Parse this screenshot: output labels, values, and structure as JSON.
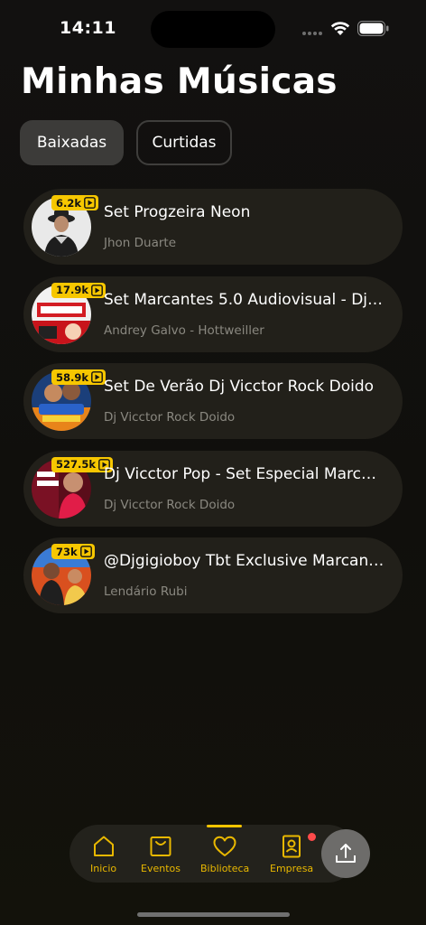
{
  "status_bar": {
    "time": "14:11"
  },
  "page": {
    "title": "Minhas Músicas"
  },
  "tabs": [
    {
      "label": "Baixadas",
      "active": true
    },
    {
      "label": "Curtidas",
      "active": false
    }
  ],
  "tracks": [
    {
      "title": "Set Progzeira Neon",
      "artist": "Jhon Duarte",
      "plays": "6.2k"
    },
    {
      "title": "Set Marcantes 5.0 Audiovisual - Dj A...",
      "artist": "Andrey Galvo - Hottweiller",
      "plays": "17.9k"
    },
    {
      "title": "Set De Verão Dj Vicctor Rock Doido",
      "artist": "Dj Vicctor Rock Doido",
      "plays": "58.9k"
    },
    {
      "title": "Dj Vicctor Pop - Set Especial Marcant...",
      "artist": "Dj Vicctor Rock Doido",
      "plays": "527.5k"
    },
    {
      "title": "@Djgigioboy Tbt Exclusive Marcante...",
      "artist": "Lendário Rubi",
      "plays": "73k"
    }
  ],
  "tabbar": {
    "items": [
      {
        "label": "Inicio",
        "icon": "home-icon"
      },
      {
        "label": "Eventos",
        "icon": "bag-icon"
      },
      {
        "label": "Biblioteca",
        "icon": "heart-icon",
        "active": true
      },
      {
        "label": "Empresa",
        "icon": "contact-card-icon",
        "notification": true
      }
    ]
  },
  "colors": {
    "accent": "#f5c400",
    "badge": "#f7c700",
    "card": "#22201a",
    "background": "#100f0c"
  }
}
